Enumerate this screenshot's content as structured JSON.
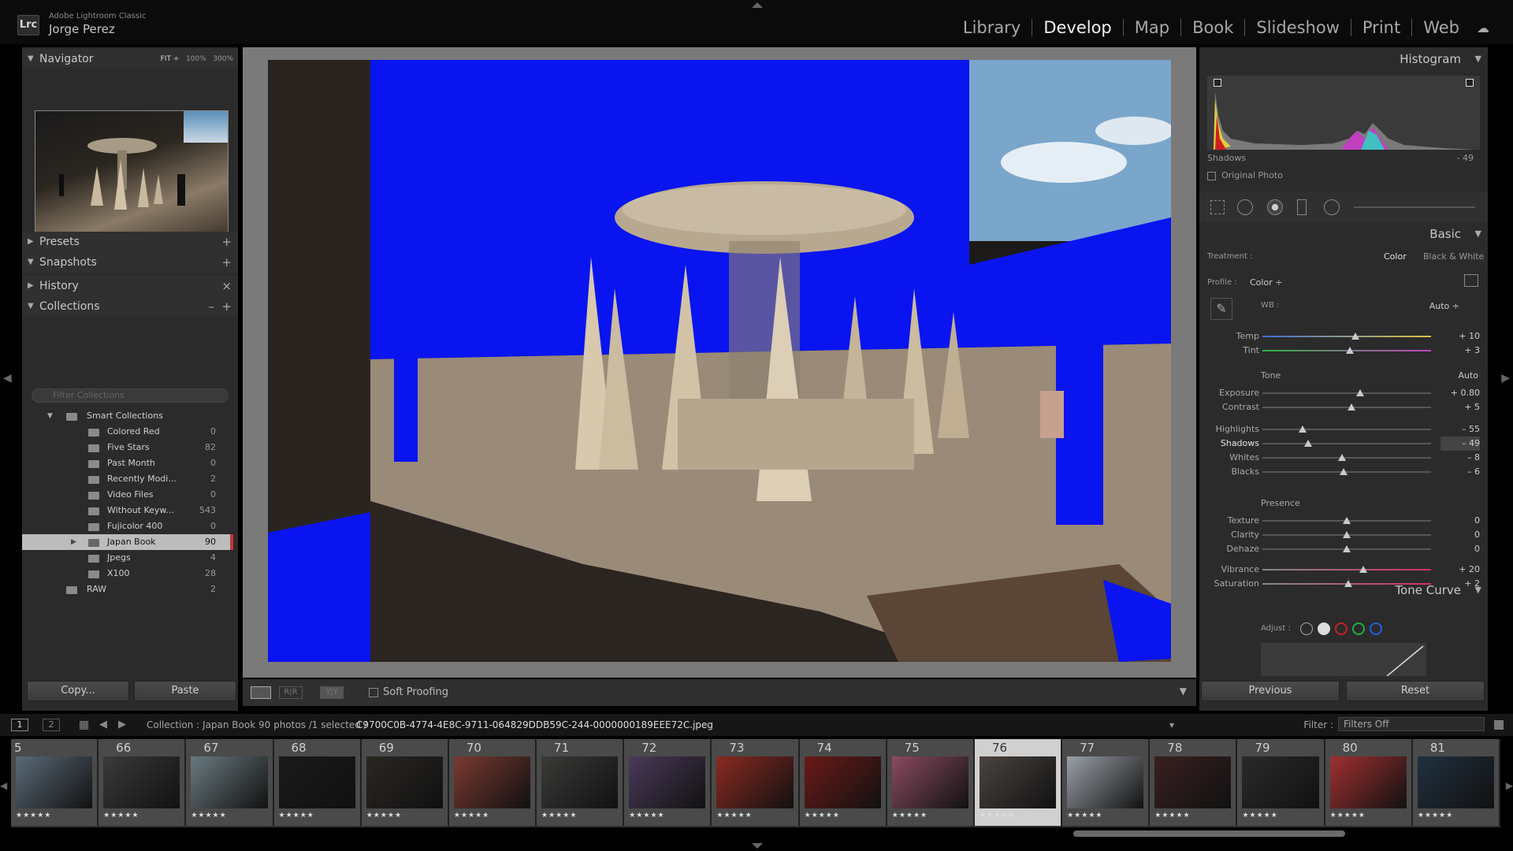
{
  "app": {
    "name": "Adobe Lightroom Classic",
    "logo": "Lrc",
    "user": "Jorge Perez"
  },
  "modules": [
    {
      "label": "Library",
      "active": false
    },
    {
      "label": "Develop",
      "active": true
    },
    {
      "label": "Map",
      "active": false
    },
    {
      "label": "Book",
      "active": false
    },
    {
      "label": "Slideshow",
      "active": false
    },
    {
      "label": "Print",
      "active": false
    },
    {
      "label": "Web",
      "active": false
    }
  ],
  "left": {
    "navigator": {
      "title": "Navigator",
      "zoom": [
        "FIT ÷",
        "100%",
        "300%"
      ]
    },
    "presets": "Presets",
    "snapshots": "Snapshots",
    "history": "History",
    "collections": {
      "title": "Collections",
      "filter_placeholder": "Filter Collections",
      "rows": [
        {
          "label": "Smart Collections",
          "count": ""
        },
        {
          "label": "Colored Red",
          "count": "0"
        },
        {
          "label": "Five Stars",
          "count": "82"
        },
        {
          "label": "Past Month",
          "count": "0"
        },
        {
          "label": "Recently Modi...",
          "count": "2"
        },
        {
          "label": "Video Files",
          "count": "0"
        },
        {
          "label": "Without Keyw...",
          "count": "543"
        },
        {
          "label": "Fujicolor 400",
          "count": "0"
        },
        {
          "label": "Japan Book",
          "count": "90"
        },
        {
          "label": "Jpegs",
          "count": "4"
        },
        {
          "label": "X100",
          "count": "28"
        },
        {
          "label": "RAW",
          "count": "2"
        }
      ]
    },
    "copy_label": "Copy...",
    "paste_label": "Paste"
  },
  "toolbar": {
    "soft_proofing": "Soft Proofing"
  },
  "right": {
    "histogram": {
      "title": "Histogram",
      "readout_label": "Shadows",
      "readout_value": "- 49",
      "original_photo": "Original Photo"
    },
    "basic": {
      "title": "Basic",
      "treatment_label": "Treatment :",
      "treatment_color": "Color",
      "treatment_bw": "Black & White",
      "profile_label": "Profile :",
      "profile_value": "Color ÷",
      "wb_label": "WB :",
      "wb_value": "Auto ÷",
      "tone_label": "Tone",
      "tone_auto": "Auto",
      "presence_label": "Presence",
      "sliders": [
        {
          "name": "Temp",
          "value": "+ 10",
          "level": 0.55
        },
        {
          "name": "Tint",
          "value": "+ 3",
          "level": 0.52
        },
        {
          "name": "Exposure",
          "value": "+ 0.80",
          "level": 0.58
        },
        {
          "name": "Contrast",
          "value": "+ 5",
          "level": 0.53
        },
        {
          "name": "Highlights",
          "value": "– 55",
          "level": 0.24
        },
        {
          "name": "Shadows",
          "value": "– 49",
          "level": 0.27
        },
        {
          "name": "Whites",
          "value": "– 8",
          "level": 0.47
        },
        {
          "name": "Blacks",
          "value": "– 6",
          "level": 0.48
        },
        {
          "name": "Texture",
          "value": "0",
          "level": 0.5
        },
        {
          "name": "Clarity",
          "value": "0",
          "level": 0.5
        },
        {
          "name": "Dehaze",
          "value": "0",
          "level": 0.5
        },
        {
          "name": "Vibrance",
          "value": "+ 20",
          "level": 0.6
        },
        {
          "name": "Saturation",
          "value": "+ 2",
          "level": 0.51
        }
      ]
    },
    "tone_curve": {
      "title": "Tone Curve",
      "adjust_label": "Adjust :"
    },
    "previous_label": "Previous",
    "reset_label": "Reset"
  },
  "filmhdr": {
    "page1": "1",
    "page2": "2",
    "source": "Collection : Japan Book",
    "count": "90 photos /1 selected /",
    "filename": "C9700C0B-4774-4E8C-9711-064829DDB59C-244-0000000189EEE72C.jpeg",
    "filter_label": "Filter :",
    "filter_value": "Filters Off"
  },
  "filmstrip": {
    "numbers": [
      "5",
      "66",
      "67",
      "68",
      "69",
      "70",
      "71",
      "72",
      "73",
      "74",
      "75",
      "76",
      "77",
      "78",
      "79",
      "80",
      "81"
    ],
    "selected_index": 11,
    "stars": "★★★★★"
  },
  "colors": {
    "clip_blue": "#0a14f0",
    "accent": "#b0b0b0",
    "selected_bar": "#c8323c"
  }
}
